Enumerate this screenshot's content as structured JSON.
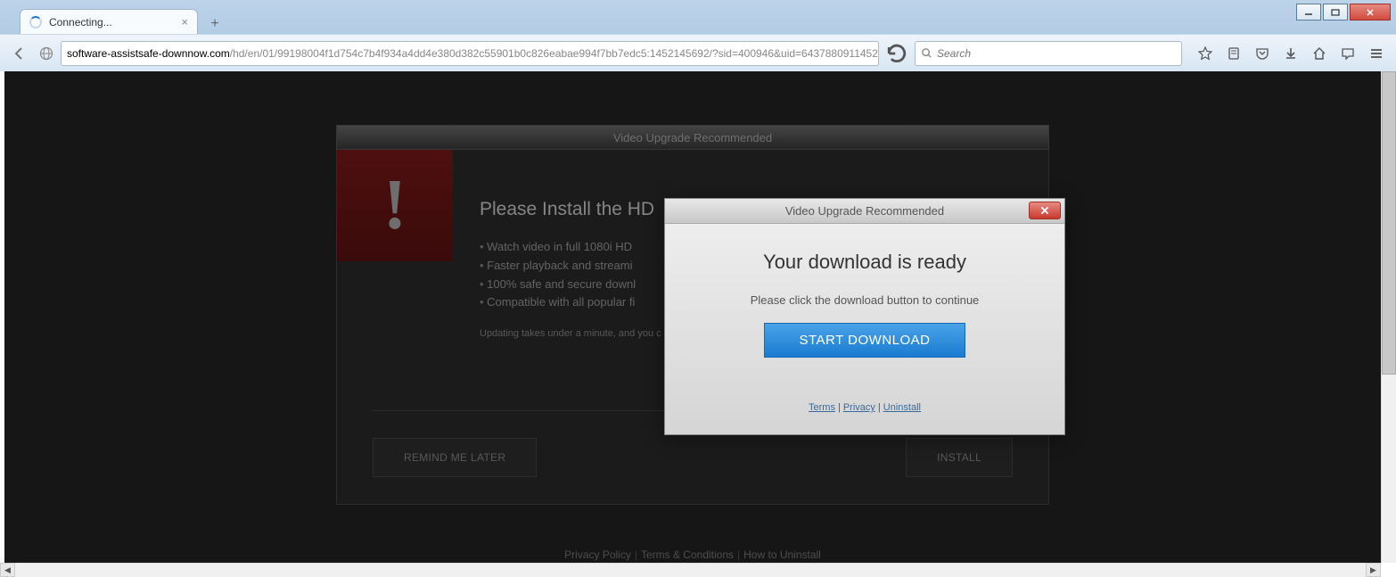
{
  "browser": {
    "tab_title": "Connecting...",
    "new_tab_symbol": "+",
    "url_domain": "software-assistsafe-downnow.com",
    "url_path": "/hd/en/01/99198004f1d754c7b4f934a4dd4e380d382c55901b0c826eabae994f7bb7edc5:1452145692/?sid=400946&uid=6437880911452:",
    "search_placeholder": "Search"
  },
  "panel": {
    "header": "Video Upgrade Recommended",
    "title": "Please Install the HD",
    "bullets": [
      "Watch video in full 1080i HD",
      "Faster playback and streami",
      "100% safe and secure downl",
      "Compatible with all popular fi"
    ],
    "update_note": "Updating takes under a minute, and you c",
    "remind_btn": "REMIND ME LATER",
    "install_btn": "INSTALL"
  },
  "popup": {
    "title": "Video Upgrade Recommended",
    "heading": "Your download is ready",
    "subtext": "Please click the download button to continue",
    "cta": "START DOWNLOAD",
    "links": {
      "terms": "Terms",
      "privacy": "Privacy",
      "uninstall": "Uninstall"
    }
  },
  "footer": {
    "privacy": "Privacy Policy",
    "terms": "Terms & Conditions",
    "uninstall": "How to Uninstall"
  }
}
